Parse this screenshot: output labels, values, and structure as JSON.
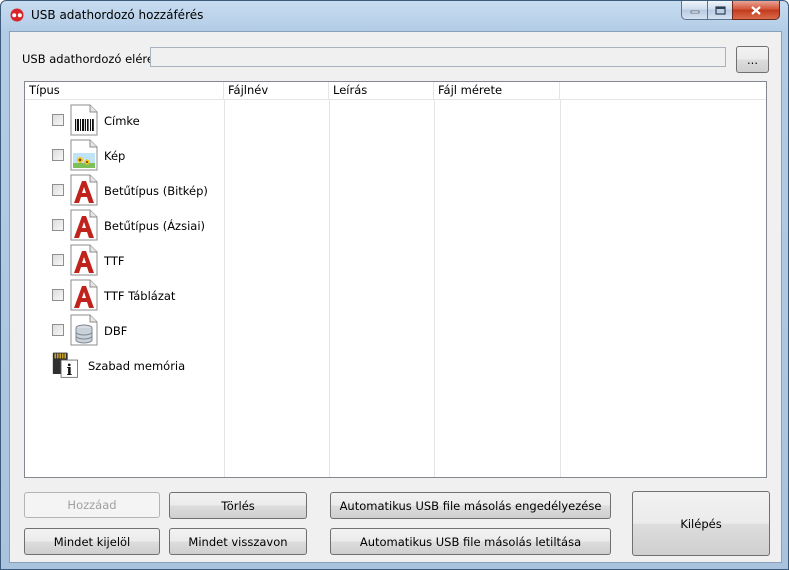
{
  "window": {
    "title": "USB adathordozó hozzáférés",
    "accent_color": "#c23a1c"
  },
  "path": {
    "label": "USB adathordozó elérés",
    "value": "",
    "browse_label": "..."
  },
  "columns": [
    "Típus",
    "Fájlnév",
    "Leírás",
    "Fájl mérete"
  ],
  "items": [
    {
      "label": "Címke",
      "icon": "barcode-file-icon",
      "checked": false
    },
    {
      "label": "Kép",
      "icon": "image-file-icon",
      "checked": false
    },
    {
      "label": "Betűtípus (Bitkép)",
      "icon": "font-file-icon",
      "checked": false
    },
    {
      "label": "Betűtípus (Ázsiai)",
      "icon": "font-file-icon",
      "checked": false
    },
    {
      "label": "TTF",
      "icon": "font-file-icon",
      "checked": false
    },
    {
      "label": "TTF Táblázat",
      "icon": "font-file-icon",
      "checked": false
    },
    {
      "label": "DBF",
      "icon": "database-file-icon",
      "checked": false
    }
  ],
  "memory": {
    "label": "Szabad memória",
    "icon": "memory-card-icon"
  },
  "buttons": {
    "add": "Hozzáad",
    "delete": "Törlés",
    "select_all": "Mindet kijelöl",
    "undo_all": "Mindet visszavon",
    "auto_enable": "Automatikus USB file másolás engedélyezése",
    "auto_disable": "Automatikus USB file másolás letiltása",
    "exit": "Kilépés"
  }
}
